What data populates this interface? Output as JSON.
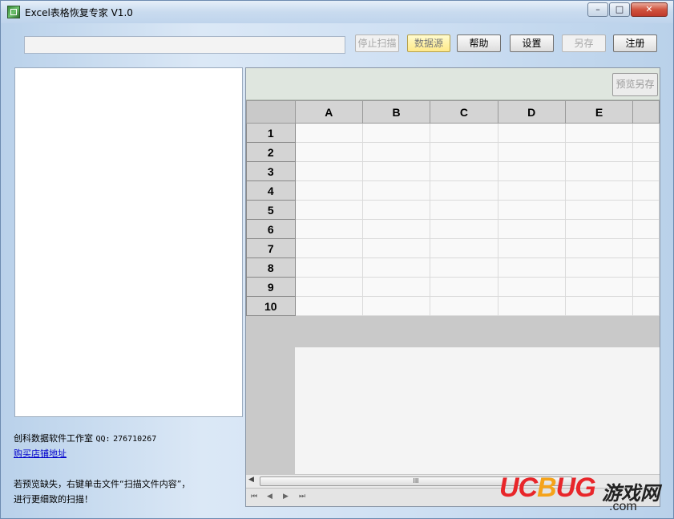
{
  "window": {
    "title": "Excel表格恢复专家 V1.0",
    "controls": {
      "minimize": "–",
      "maximize": "□",
      "close": "✕"
    }
  },
  "toolbar": {
    "path_value": "",
    "stop_scan_label": "停止扫描",
    "data_source_label": "数据源",
    "help_label": "帮助",
    "settings_label": "设置",
    "save_as_label": "另存",
    "register_label": "注册"
  },
  "preview": {
    "save_as_label": "预览另存"
  },
  "grid": {
    "columns": [
      "A",
      "B",
      "C",
      "D",
      "E"
    ],
    "rows": [
      "1",
      "2",
      "3",
      "4",
      "5",
      "6",
      "7",
      "8",
      "9",
      "10"
    ]
  },
  "info": {
    "studio": "创科数据软件工作室",
    "qq_label": "QQ:",
    "qq_number": "276710267",
    "shop_link": "购买店铺地址",
    "hint_line1": "若预览缺失，右键单击文件“扫描文件内容”，",
    "hint_line2": "进行更细致的扫描！"
  },
  "scrollbar": {
    "thumb_grip": "III"
  },
  "sheet_nav": {
    "first": "⏮",
    "prev": "◀",
    "next": "▶",
    "last": "⏭"
  },
  "watermark": {
    "brand_uc": "UC",
    "brand_o": "B",
    "brand_ug": "UG",
    "brand_cn": "游戏网",
    "brand_com": ".com"
  },
  "colors": {
    "accent_red": "#e8262a",
    "accent_orange": "#f5a31a",
    "link": "#0000cc"
  }
}
